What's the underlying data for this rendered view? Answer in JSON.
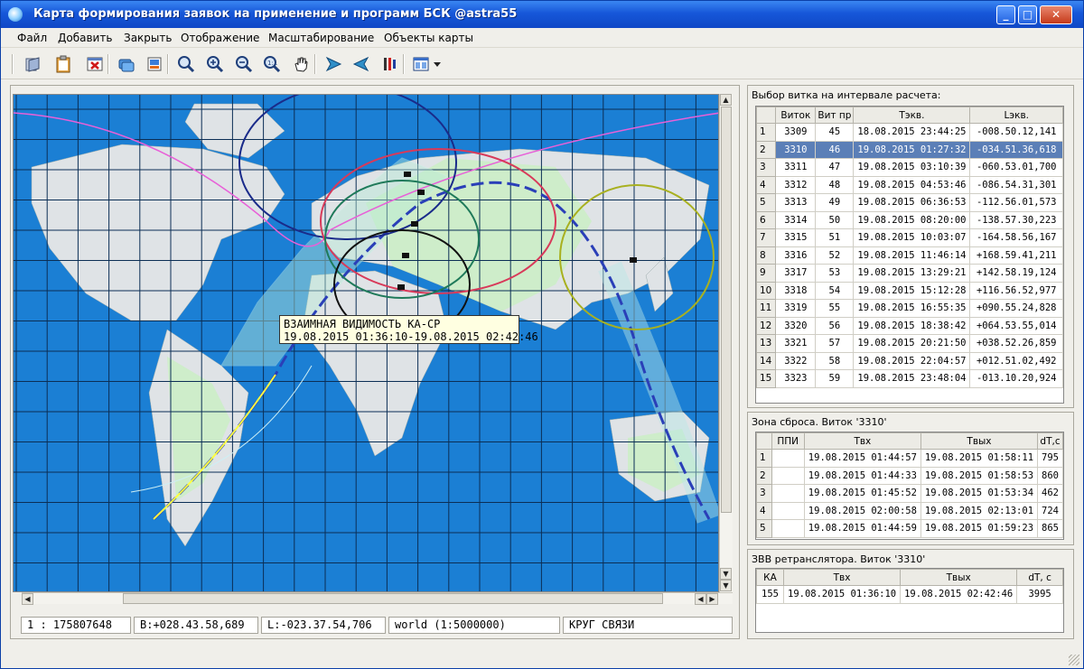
{
  "window": {
    "title": "Карта формирования заявок на применение и программ БСК @astra55",
    "minimize": "_",
    "maximize": "□",
    "close": "✕"
  },
  "menu": [
    "Файл",
    "Добавить",
    "Закрыть",
    "Отображение",
    "Масштабирование",
    "Объекты карты"
  ],
  "toolbar": {
    "icons": [
      "open-icon",
      "clipboard-icon",
      "close-map-icon",
      "layers-icon",
      "export-icon",
      "zoom-icon",
      "zoom-in-icon",
      "zoom-out-icon",
      "zoom-reset-icon",
      "pan-hand-icon",
      "arrow-right-icon",
      "arrow-left-icon",
      "marker-icon",
      "panel-layout-icon"
    ]
  },
  "map": {
    "tooltip_line1": "ВЗАИМНАЯ ВИДИМОСТЬ КА-СР",
    "tooltip_line2": "19.08.2015 01:36:10-19.08.2015 02:42:46"
  },
  "status": {
    "scale": "1 :  175807648",
    "lat": "B:+028.43.58,689",
    "lon": "L:-023.37.54,706",
    "layer": "world (1:5000000)",
    "mode": "КРУГ СВЯЗИ"
  },
  "orbits": {
    "title": "Выбор витка на интервале расчета:",
    "columns": [
      "Виток",
      "Вит пр",
      "Тэкв.",
      "Lэкв."
    ],
    "selected_row": 2,
    "rows": [
      [
        "1",
        "3309",
        "45",
        "18.08.2015 23:44:25",
        "-008.50.12,141"
      ],
      [
        "2",
        "3310",
        "46",
        "19.08.2015 01:27:32",
        "-034.51.36,618"
      ],
      [
        "3",
        "3311",
        "47",
        "19.08.2015 03:10:39",
        "-060.53.01,700"
      ],
      [
        "4",
        "3312",
        "48",
        "19.08.2015 04:53:46",
        "-086.54.31,301"
      ],
      [
        "5",
        "3313",
        "49",
        "19.08.2015 06:36:53",
        "-112.56.01,573"
      ],
      [
        "6",
        "3314",
        "50",
        "19.08.2015 08:20:00",
        "-138.57.30,223"
      ],
      [
        "7",
        "3315",
        "51",
        "19.08.2015 10:03:07",
        "-164.58.56,167"
      ],
      [
        "8",
        "3316",
        "52",
        "19.08.2015 11:46:14",
        "+168.59.41,211"
      ],
      [
        "9",
        "3317",
        "53",
        "19.08.2015 13:29:21",
        "+142.58.19,124"
      ],
      [
        "10",
        "3318",
        "54",
        "19.08.2015 15:12:28",
        "+116.56.52,977"
      ],
      [
        "11",
        "3319",
        "55",
        "19.08.2015 16:55:35",
        "+090.55.24,828"
      ],
      [
        "12",
        "3320",
        "56",
        "19.08.2015 18:38:42",
        "+064.53.55,014"
      ],
      [
        "13",
        "3321",
        "57",
        "19.08.2015 20:21:50",
        "+038.52.26,859"
      ],
      [
        "14",
        "3322",
        "58",
        "19.08.2015 22:04:57",
        "+012.51.02,492"
      ],
      [
        "15",
        "3323",
        "59",
        "19.08.2015 23:48:04",
        "-013.10.20,924"
      ]
    ]
  },
  "drop_zone": {
    "title": "Зона сброса.  Виток '3310'",
    "columns": [
      "ППИ",
      "Твх",
      "Твых",
      "dT,c"
    ],
    "rows": [
      [
        "1",
        "",
        "19.08.2015 01:44:57",
        "19.08.2015 01:58:11",
        "795"
      ],
      [
        "2",
        "",
        "19.08.2015 01:44:33",
        "19.08.2015 01:58:53",
        "860"
      ],
      [
        "3",
        "",
        "19.08.2015 01:45:52",
        "19.08.2015 01:53:34",
        "462"
      ],
      [
        "4",
        "",
        "19.08.2015 02:00:58",
        "19.08.2015 02:13:01",
        "724"
      ],
      [
        "5",
        "",
        "19.08.2015 01:44:59",
        "19.08.2015 01:59:23",
        "865"
      ]
    ]
  },
  "relay": {
    "title": "ЗВВ ретранслятора. Виток '3310'",
    "columns": [
      "КА",
      "Твх",
      "Твых",
      "dT, c"
    ],
    "rows": [
      [
        "155",
        "19.08.2015 01:36:10",
        "19.08.2015 02:42:46",
        "3995"
      ]
    ]
  }
}
